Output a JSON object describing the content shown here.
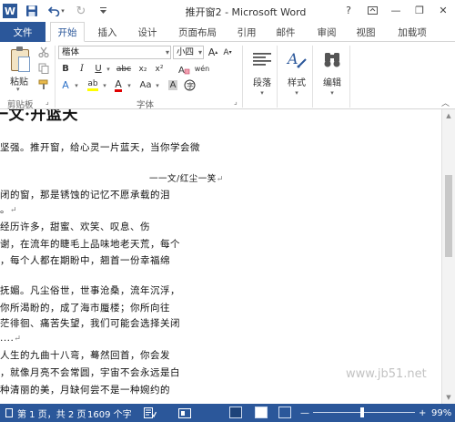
{
  "window": {
    "title": "推开窗2 - Microsoft Word",
    "help": "?",
    "controls": {
      "minimize": "—",
      "restore": "❐",
      "close": "✕"
    }
  },
  "quick_access": {
    "app_icon": "W",
    "undo_arrow": "▾",
    "redo": "↻"
  },
  "tabs": {
    "file": "文件",
    "items": [
      "开始",
      "插入",
      "设计",
      "页面布局",
      "引用",
      "邮件",
      "审阅",
      "视图",
      "加载项"
    ],
    "active": "开始"
  },
  "ribbon": {
    "clipboard": {
      "paste_label": "粘贴",
      "group_label": "剪贴板"
    },
    "font": {
      "font_name": "楷体",
      "font_size": "小四",
      "grow": "A",
      "shrink": "A",
      "clear": "A",
      "wen": "wén",
      "bold": "B",
      "italic": "I",
      "underline": "U",
      "strike": "abc",
      "subscript": "x₂",
      "superscript": "x²",
      "text_effect": "A",
      "highlight": "ab",
      "font_color": "A",
      "case": "Aa",
      "grow_shrink_arrows": "▾",
      "group_label": "字体"
    },
    "paragraph": {
      "label": "段落"
    },
    "styles": {
      "label": "样式"
    },
    "editing": {
      "label": "编辑"
    },
    "accent_color": "#2b579a",
    "highlight_color": "#ffff00",
    "font_color_bar": "#e00000"
  },
  "document": {
    "heading": "一文·开篮天",
    "lines": [
      "坚强。推开窗，给心灵一片蓝天，当你学会微",
      "一一文/红尘一笑",
      "闭的窗，那是锈蚀的记忆不愿承载的泪",
      "。",
      "经历许多，甜蜜、欢笑、叹息、伤",
      "谢，在流年的睫毛上品味地老天荒，每个",
      "，每个人都在期盼中，翘首一份幸福绵",
      "抚媚。凡尘俗世，世事沧桑，流年沉浮，",
      "你所渴盼的，成了海市蜃楼；你所向往",
      "茫徘徊、痛苦失望，我们可能会选择关闭",
      "....",
      "人生的九曲十八弯，蓦然回首，你会发",
      "，就像月亮不会常圆，宇宙不会永远是白",
      "种清丽的美，月缺何尝不是一种婉约的"
    ],
    "para_mark": "↵"
  },
  "watermark": "www.jb51.net",
  "status": {
    "page": "第 1 页，共 2 页",
    "words": "1609 个字",
    "zoom": "99%",
    "zoom_minus": "—",
    "zoom_plus": "+"
  }
}
